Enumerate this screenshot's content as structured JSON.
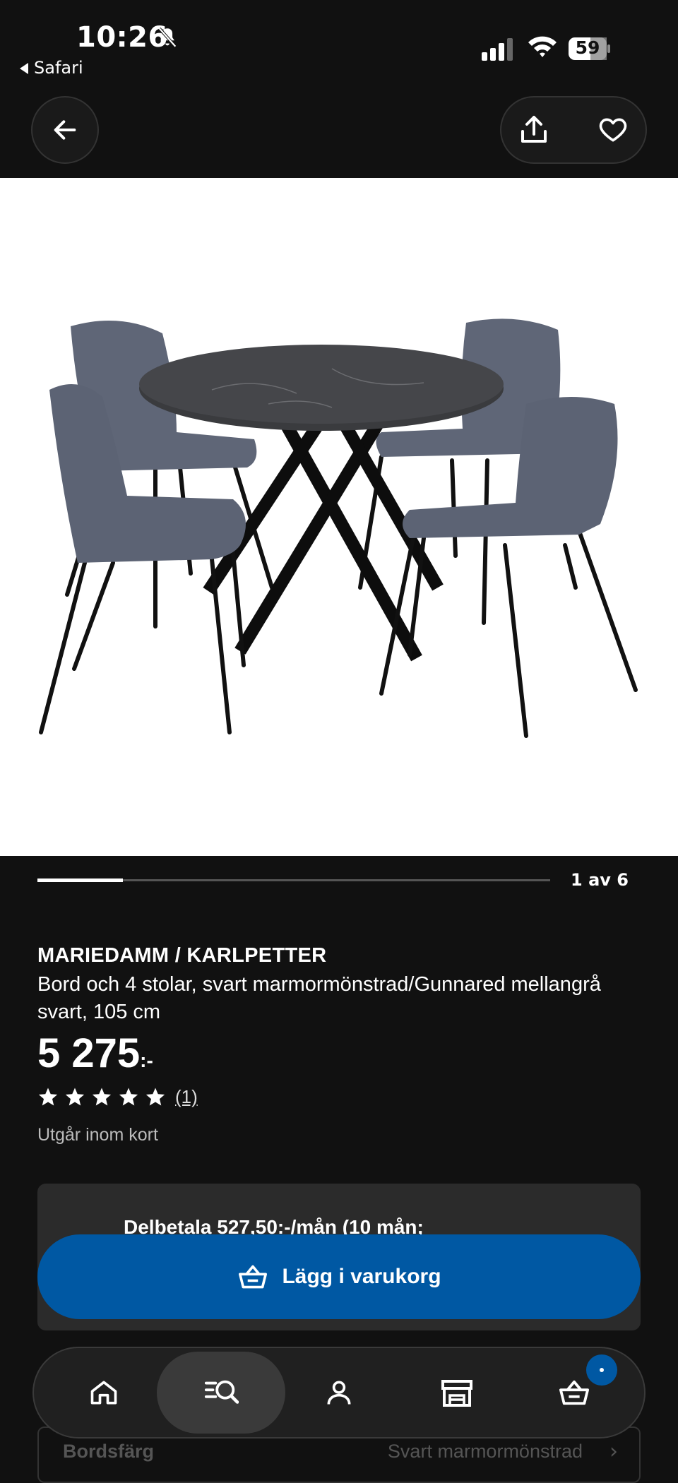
{
  "status_bar": {
    "time": "10:26",
    "back_app_label": "Safari",
    "battery_level": "59",
    "icons": [
      "bell-slash-icon",
      "signal-icon",
      "wifi-icon",
      "battery-icon"
    ]
  },
  "top_nav": {
    "icons": [
      "arrow-left-icon",
      "share-icon",
      "heart-icon"
    ]
  },
  "gallery": {
    "pager_text": "1 av 6",
    "progress_fraction": 0.167
  },
  "product": {
    "name": "MARIEDAMM / KARLPETTER",
    "description": "Bord och 4 stolar, svart marmormönstrad/Gunnared mellangrå svart, 105 cm",
    "price_main": "5 275",
    "price_suffix": ":-",
    "rating_stars": 5,
    "rating_count": "(1)",
    "availability": "Utgår inom kort"
  },
  "purchase": {
    "installment_text": "Delbetala 527,50:-/mån (10 mån;",
    "add_to_cart_label": "Lägg i varukorg",
    "add_to_cart_icon": "basket-icon"
  },
  "options_row": {
    "label": "Bordsfärg",
    "value": "Svart marmormönstrad"
  },
  "tab_bar": {
    "tabs": [
      "home-icon",
      "search-list-icon",
      "person-icon",
      "store-icon",
      "basket-icon"
    ],
    "active": "search-list-icon"
  },
  "colors": {
    "background": "#111111",
    "accent_blue": "#0058a3",
    "card": "#2b2b2b"
  }
}
